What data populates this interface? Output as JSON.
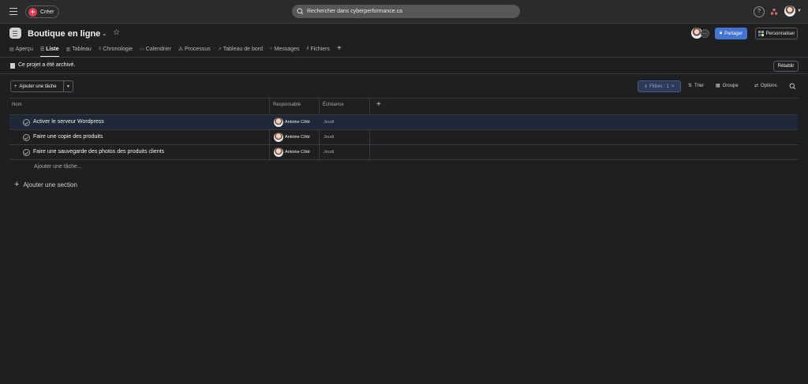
{
  "topbar": {
    "create_label": "Créer",
    "search_placeholder": "Rechercher dans cyberperformance.ca",
    "help_label": "?"
  },
  "project": {
    "title": "Boutique en ligne",
    "share_label": "Partager",
    "customize_label": "Personnaliser"
  },
  "tabs": [
    {
      "label": "Aperçu",
      "icon": "overview-icon"
    },
    {
      "label": "Liste",
      "icon": "list-icon",
      "active": true
    },
    {
      "label": "Tableau",
      "icon": "board-icon"
    },
    {
      "label": "Chronologie",
      "icon": "timeline-icon"
    },
    {
      "label": "Calendrier",
      "icon": "calendar-icon"
    },
    {
      "label": "Processus",
      "icon": "workflow-icon"
    },
    {
      "label": "Tableau de bord",
      "icon": "dashboard-icon"
    },
    {
      "label": "Messages",
      "icon": "messages-icon"
    },
    {
      "label": "Fichiers",
      "icon": "files-icon"
    }
  ],
  "archive": {
    "text": "Ce projet a été archivé.",
    "restore_label": "Rétablir"
  },
  "toolbar": {
    "add_task_label": "Ajouter une tâche",
    "filters_label": "Filtres : 1",
    "sort_label": "Trier",
    "group_label": "Groupe",
    "options_label": "Options"
  },
  "table": {
    "columns": [
      "Nom",
      "Responsable",
      "Échéance"
    ],
    "rows": [
      {
        "name": "Activer le serveur Wordpress",
        "assignee": "Antoine Côté",
        "due": "Jeudi"
      },
      {
        "name": "Faire une copie des produits",
        "assignee": "Antoine Côté",
        "due": "Jeudi"
      },
      {
        "name": "Faire une sauvegarde des photos des produits clients",
        "assignee": "Antoine Côté",
        "due": "Jeudi"
      }
    ],
    "add_task_placeholder": "Ajouter une tâche...",
    "add_section_label": "Ajouter une section"
  },
  "colors": {
    "background": "#1e1f21",
    "topbar": "#2a2b2d",
    "accent": "#4573d2",
    "create": "#e8384f",
    "filter_bg": "#2e3a55",
    "filter_text": "#8fb0ee"
  }
}
